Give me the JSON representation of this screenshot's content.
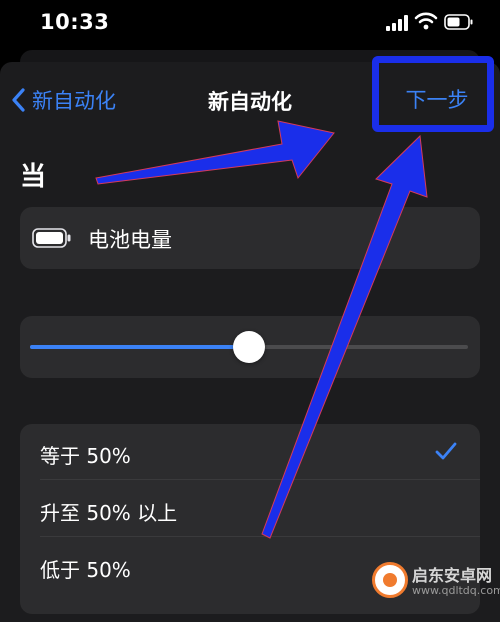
{
  "status_bar": {
    "time": "10:33",
    "icons": [
      "cellular-signal-icon",
      "wifi-icon",
      "battery-icon"
    ]
  },
  "nav": {
    "back_label": "新自动化",
    "title": "新自动化",
    "next_label": "下一步"
  },
  "section": {
    "when_label": "当"
  },
  "trigger": {
    "icon": "battery-icon",
    "label": "电池电量"
  },
  "slider": {
    "value_percent": 50
  },
  "options": [
    {
      "label": "等于 50%",
      "selected": true
    },
    {
      "label": "升至 50% 以上",
      "selected": false
    },
    {
      "label": "低于 50%",
      "selected": false
    }
  ],
  "annotation": {
    "highlight_color": "#1a2eea",
    "arrow_color": "#1a2eea"
  },
  "watermark": {
    "name": "启东安卓网",
    "url": "www.qdltdq.com"
  },
  "colors": {
    "accent": "#3b82f6",
    "background": "#000000",
    "sheet": "#1c1c1e",
    "card": "#2c2c2e"
  }
}
